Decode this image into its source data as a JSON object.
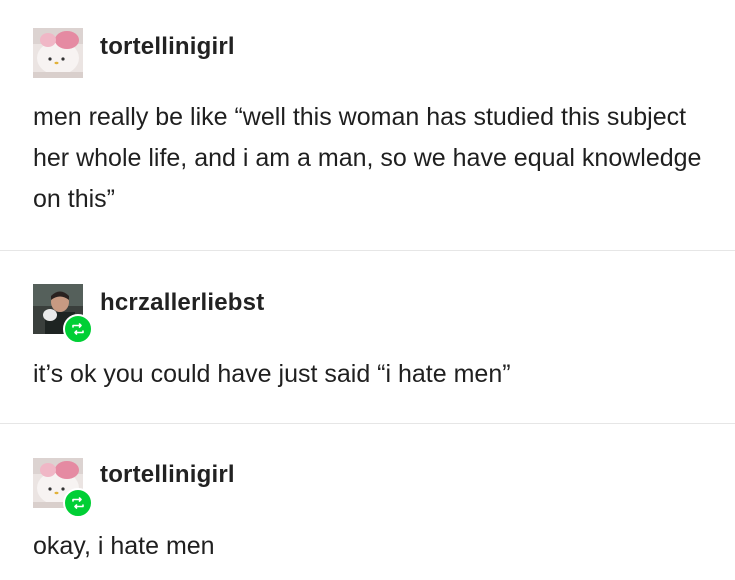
{
  "posts": [
    {
      "username": "tortellinigirl",
      "avatar_icon": "cat-avatar-icon",
      "reblogged": false,
      "text": "men really be like “well this woman has studied this subject her whole life, and i am a man, so we have equal knowledge on this”"
    },
    {
      "username": "hcrzallerliebst",
      "avatar_icon": "person-avatar-icon",
      "reblogged": true,
      "reblog_icon": "reblog-icon",
      "text": "it’s ok you could have just said “i hate men”"
    },
    {
      "username": "tortellinigirl",
      "avatar_icon": "cat-avatar-icon",
      "reblogged": true,
      "reblog_icon": "reblog-icon",
      "text": "okay, i hate men"
    }
  ],
  "colors": {
    "reblog_badge": "#00cf35",
    "divider": "#e6e6e6",
    "text": "#222222"
  }
}
